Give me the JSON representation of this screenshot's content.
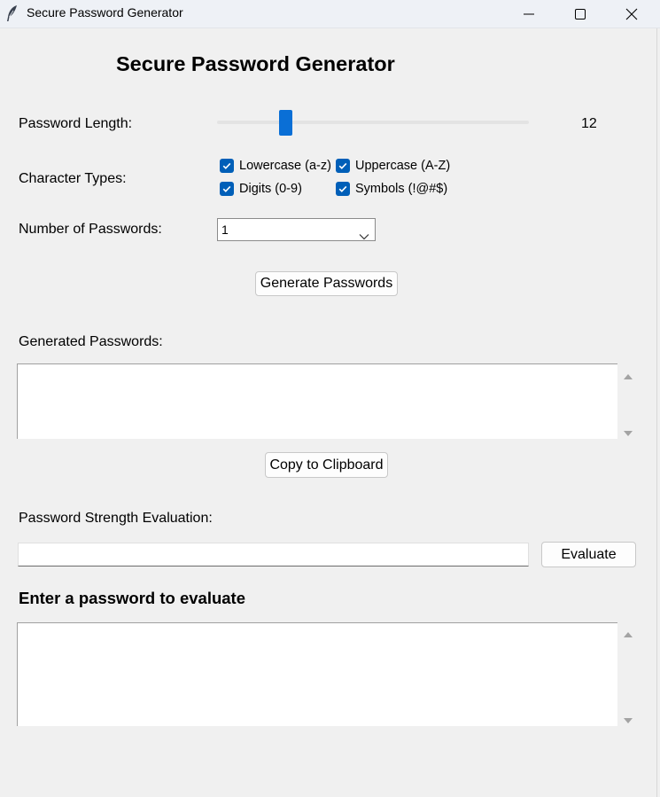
{
  "window": {
    "title": "Secure Password Generator"
  },
  "heading": "Secure Password Generator",
  "length": {
    "label": "Password Length:",
    "value": "12",
    "slider_fraction": 0.22
  },
  "char_types": {
    "label": "Character Types:",
    "options": [
      {
        "label": "Lowercase (a-z)",
        "checked": true
      },
      {
        "label": "Uppercase (A-Z)",
        "checked": true
      },
      {
        "label": "Digits (0-9)",
        "checked": true
      },
      {
        "label": "Symbols (!@#$)",
        "checked": true
      }
    ]
  },
  "count": {
    "label": "Number of Passwords:",
    "value": "1"
  },
  "generate_button": "Generate Passwords",
  "generated": {
    "label": "Generated Passwords:",
    "content": ""
  },
  "copy_button": "Copy to Clipboard",
  "strength": {
    "label": "Password Strength Evaluation:",
    "input_value": "",
    "evaluate_button": "Evaluate",
    "result_heading": "Enter a password to evaluate",
    "result_content": ""
  },
  "colors": {
    "accent": "#005fb8",
    "slider_thumb": "#0a6fd6",
    "background": "#f0f0f0"
  },
  "icons": {
    "app": "feather-icon",
    "minimize": "minimize-icon",
    "maximize": "maximize-icon",
    "close": "close-icon"
  }
}
